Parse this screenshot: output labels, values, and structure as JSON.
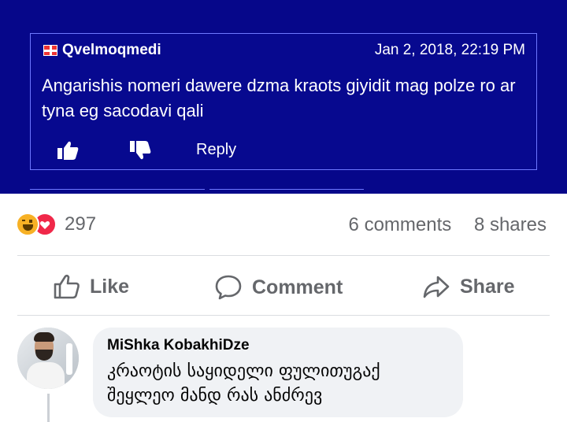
{
  "embedded_comment": {
    "username": "Qvelmoqmedi",
    "timestamp": "Jan 2, 2018, 22:19 PM",
    "text": "Angarishis nomeri dawere dzma kraots giyidit mag polze ro ar tyna eg sacodavi qali",
    "reply_label": "Reply",
    "colors": {
      "background": "#06078a",
      "border": "#6e78ff",
      "text": "#ffffff"
    }
  },
  "post_stats": {
    "reactions": [
      "haha",
      "love"
    ],
    "reaction_count": "297",
    "comments": "6 comments",
    "shares": "8 shares"
  },
  "actions": {
    "like": "Like",
    "comment": "Comment",
    "share": "Share"
  },
  "comment": {
    "author": "MiShka KobakhiDze",
    "line1": "კრაოტის საყიდელი ფულითუგაქ",
    "line2": "შეყლეო მანდ რას ანძრევ"
  },
  "icons": [
    "flag-icon",
    "thumbs-up-icon",
    "thumbs-down-icon",
    "haha-reaction-icon",
    "love-reaction-icon",
    "like-icon",
    "comment-icon",
    "share-icon"
  ],
  "theme": {
    "secondary_text": "#65676b",
    "bubble": "#f0f2f5",
    "divider": "#dadde1"
  }
}
